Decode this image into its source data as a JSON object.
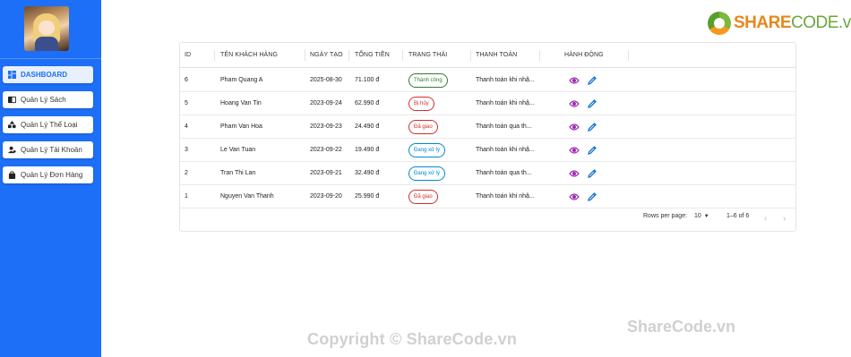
{
  "sidebar": {
    "items": [
      {
        "label": "DASHBOARD",
        "icon": "dashboard-icon",
        "active": true
      },
      {
        "label": "Quản Lý Sách",
        "icon": "book-icon"
      },
      {
        "label": "Quản Lý Thể Loại",
        "icon": "category-icon"
      },
      {
        "label": "Quản Lý Tài Khoản",
        "icon": "manage-accounts-icon"
      },
      {
        "label": "Quản Lý Đơn Hàng",
        "icon": "shopping-bag-icon"
      }
    ]
  },
  "logo": {
    "brand": "SHARE",
    "brand2": "CODE",
    "tld": ".vn"
  },
  "table": {
    "headers": [
      "ID",
      "TÊN KHÁCH HÀNG",
      "NGÀY TẠO",
      "TỔNG TIỀN",
      "TRẠNG THÁI",
      "THANH TOÁN",
      "HÀNH ĐỘNG"
    ],
    "rows": [
      {
        "id": "6",
        "customer": "Pham Quang A",
        "date": "2025-08-30",
        "total": "71.100 đ",
        "status": "Thành công",
        "payment": "Thanh toán khi nhậ..."
      },
      {
        "id": "5",
        "customer": "Hoang Van Tin",
        "date": "2023-09-24",
        "total": "62.990 đ",
        "status": "Bị hủy",
        "payment": "Thanh toán khi nhậ..."
      },
      {
        "id": "4",
        "customer": "Pham Van Hoa",
        "date": "2023-09-23",
        "total": "24.490 đ",
        "status": "Đã giao",
        "payment": "Thanh toán qua th..."
      },
      {
        "id": "3",
        "customer": "Le Van Tuan",
        "date": "2023-09-22",
        "total": "19.490 đ",
        "status": "Đang xử lý",
        "payment": "Thanh toán khi nhậ..."
      },
      {
        "id": "2",
        "customer": "Tran Thi Lan",
        "date": "2023-09-21",
        "total": "32.490 đ",
        "status": "Đang xử lý",
        "payment": "Thanh toán qua th..."
      },
      {
        "id": "1",
        "customer": "Nguyen Van Thanh",
        "date": "2023-09-20",
        "total": "25.990 đ",
        "status": "Đã giao",
        "payment": "Thanh toán khi nhậ..."
      }
    ],
    "status_colors": {
      "Thành công": "#2e7d32",
      "Bị hủy": "#d32f2f",
      "Đã giao": "#d32f2f",
      "Đang xử lý": "#0288d1"
    },
    "action_colors": {
      "view": "#9c27b0",
      "edit": "#1976d2"
    }
  },
  "pagination": {
    "rows_per_page_label": "Rows per page:",
    "rows_per_page": "10",
    "range": "1–6 of 6"
  },
  "watermarks": {
    "center": "Copyright © ShareCode.vn",
    "right": "ShareCode.vn"
  }
}
